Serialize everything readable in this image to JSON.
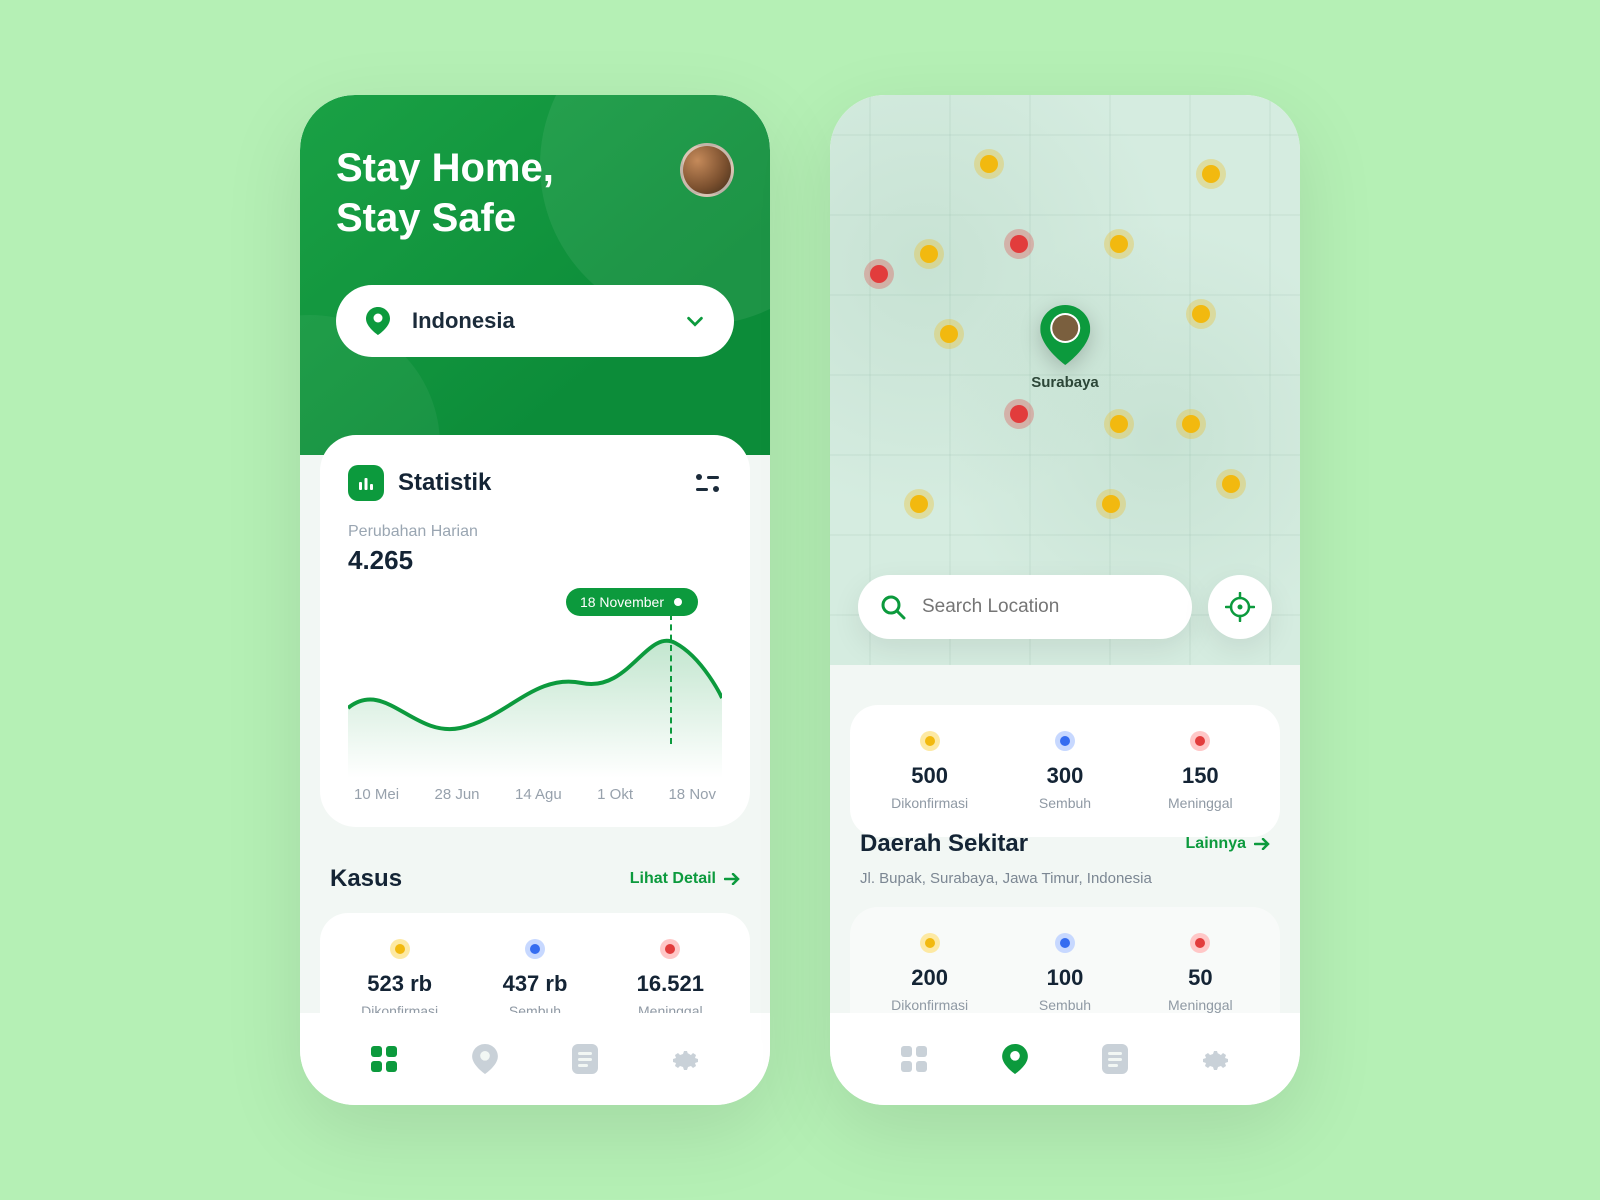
{
  "left": {
    "hero_title_line1": "Stay Home,",
    "hero_title_line2": "Stay Safe",
    "country": "Indonesia",
    "stats_title": "Statistik",
    "change_label": "Perubahan Harian",
    "change_value": "4.265",
    "date_tag": "18 November",
    "x_axis": [
      "10 Mei",
      "28 Jun",
      "14 Agu",
      "1 Okt",
      "18 Nov"
    ],
    "kasus_title": "Kasus",
    "detail_link": "Lihat Detail",
    "kasus": [
      {
        "value": "523 rb",
        "label": "Dikonfirmasi",
        "color": "yellow"
      },
      {
        "value": "437 rb",
        "label": "Sembuh",
        "color": "blue"
      },
      {
        "value": "16.521",
        "label": "Meninggal",
        "color": "red"
      }
    ]
  },
  "right": {
    "pin_label": "Surabaya",
    "search_placeholder": "Search Location",
    "top_stats": [
      {
        "value": "500",
        "label": "Dikonfirmasi",
        "color": "yellow"
      },
      {
        "value": "300",
        "label": "Sembuh",
        "color": "blue"
      },
      {
        "value": "150",
        "label": "Meninggal",
        "color": "red"
      }
    ],
    "nearby_title": "Daerah Sekitar",
    "nearby_link": "Lainnya",
    "address": "Jl. Bupak, Surabaya, Jawa Timur, Indonesia",
    "nearby_stats": [
      {
        "value": "200",
        "label": "Dikonfirmasi",
        "color": "yellow"
      },
      {
        "value": "100",
        "label": "Sembuh",
        "color": "blue"
      },
      {
        "value": "50",
        "label": "Meninggal",
        "color": "red"
      }
    ]
  },
  "colors": {
    "accent": "#0c9a3d",
    "text": "#142435",
    "muted": "#8f99a4"
  },
  "chart_data": {
    "type": "line",
    "title": "Perubahan Harian",
    "ylabel": "",
    "xlabel": "",
    "categories": [
      "10 Mei",
      "28 Jun",
      "14 Agu",
      "1 Okt",
      "18 Nov"
    ],
    "values": [
      2800,
      2300,
      3400,
      3000,
      4265
    ],
    "highlight": {
      "index": 4,
      "label": "18 November",
      "value": 4265
    },
    "ylim": [
      0,
      5000
    ]
  }
}
